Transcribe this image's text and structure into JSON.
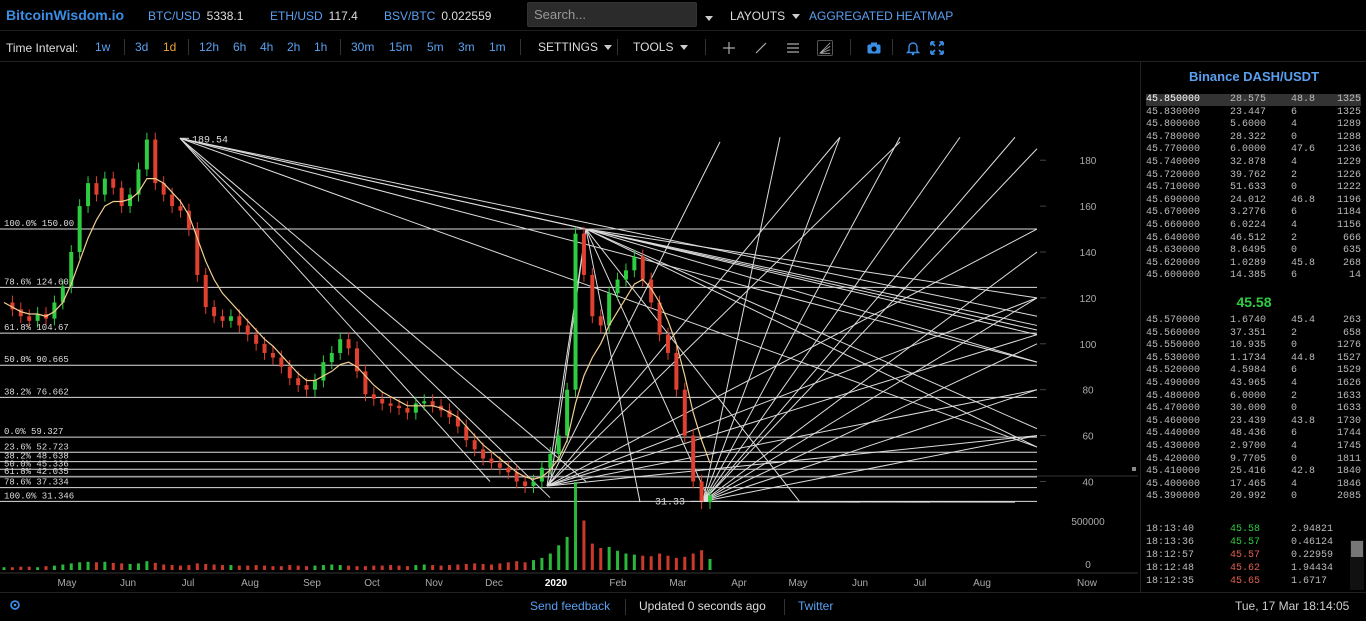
{
  "header": {
    "logo": "BitcoinWisdom.io",
    "tickers": [
      {
        "name": "BTC/USD",
        "value": "5338.1"
      },
      {
        "name": "ETH/USD",
        "value": "117.4"
      },
      {
        "name": "BSV/BTC",
        "value": "0.022559"
      }
    ],
    "search_placeholder": "Search...",
    "layouts_label": "LAYOUTS",
    "heatmap_label": "AGGREGATED HEATMAP"
  },
  "toolbar": {
    "interval_label": "Time Interval:",
    "intervals": [
      "1w",
      "3d",
      "1d",
      "12h",
      "6h",
      "4h",
      "2h",
      "1h",
      "30m",
      "15m",
      "5m",
      "3m",
      "1m"
    ],
    "active_interval": "1d",
    "settings_label": "SETTINGS",
    "tools_label": "TOOLS",
    "tool_icons": [
      "crosshair-icon",
      "line-icon",
      "horizontal-lines-icon",
      "fib-icon",
      "camera-icon",
      "bell-icon",
      "fullscreen-icon"
    ]
  },
  "chart_data": {
    "type": "line",
    "title": "",
    "xlabel": "",
    "ylabel": "",
    "y_ticks": [
      40,
      60,
      80,
      100,
      120,
      140,
      160,
      180
    ],
    "ylim": [
      30,
      195
    ],
    "volume_ticks": [
      "500000",
      "0"
    ],
    "x_ticks": [
      "May",
      "Jun",
      "Jul",
      "Aug",
      "Sep",
      "Oct",
      "Nov",
      "Dec",
      "2020",
      "Feb",
      "Mar",
      "Apr",
      "May",
      "Jun",
      "Jul",
      "Aug",
      "Now"
    ],
    "fib_levels_1": [
      {
        "label": "100.0% 150.00",
        "value": 150.0
      },
      {
        "label": "78.6% 124.60",
        "value": 124.6
      },
      {
        "label": "61.8% 104.67",
        "value": 104.67
      },
      {
        "label": "50.0% 90.665",
        "value": 90.665
      },
      {
        "label": "38.2% 76.662",
        "value": 76.662
      },
      {
        "label": "0.0% 59.327",
        "value": 59.327
      }
    ],
    "fib_levels_2": [
      {
        "label": "23.6% 52.723",
        "value": 52.723
      },
      {
        "label": "38.2% 48.638",
        "value": 48.638
      },
      {
        "label": "50.0% 45.336",
        "value": 45.336
      },
      {
        "label": "61.8% 42.035",
        "value": 42.035
      },
      {
        "label": "78.6% 37.334",
        "value": 37.334
      },
      {
        "label": "100.0% 31.346",
        "value": 31.346
      }
    ],
    "high_label": "189.54",
    "high_value": 189.54,
    "low_label": "31.33",
    "low_value": 31.33,
    "price_series": [
      118,
      115,
      112,
      110,
      113,
      111,
      118,
      125,
      140,
      160,
      170,
      165,
      172,
      168,
      160,
      165,
      176,
      189,
      170,
      165,
      160,
      158,
      150,
      130,
      116,
      112,
      110,
      112,
      108,
      104,
      100,
      96,
      94,
      90,
      85,
      82,
      80,
      84,
      92,
      96,
      102,
      98,
      88,
      78,
      76,
      74,
      73,
      72,
      70,
      74,
      75,
      73,
      71,
      68,
      64,
      58,
      54,
      50,
      48,
      46,
      44,
      40,
      38,
      40,
      46,
      52,
      60,
      80,
      148,
      130,
      112,
      108,
      122,
      128,
      132,
      138,
      128,
      118,
      104,
      96,
      80,
      60,
      40,
      31,
      34
    ],
    "ma_series": [
      118,
      116,
      114,
      113,
      113,
      112,
      114,
      118,
      126,
      136,
      146,
      154,
      160,
      162,
      162,
      163,
      166,
      172,
      172,
      170,
      166,
      162,
      156,
      146,
      136,
      128,
      122,
      118,
      114,
      110,
      106,
      102,
      99,
      95,
      91,
      87,
      84,
      84,
      86,
      88,
      91,
      92,
      90,
      86,
      82,
      79,
      77,
      75,
      73,
      73,
      73,
      73,
      72,
      70,
      68,
      64,
      60,
      56,
      53,
      50,
      47,
      44,
      42,
      41,
      42,
      45,
      50,
      58,
      74,
      86,
      94,
      100,
      108,
      114,
      120,
      126,
      128,
      124,
      118,
      110,
      100,
      86,
      70,
      58,
      48
    ],
    "volume_series": [
      5,
      5,
      6,
      6,
      5,
      7,
      8,
      10,
      12,
      14,
      15,
      14,
      15,
      13,
      12,
      11,
      12,
      16,
      13,
      10,
      9,
      8,
      9,
      12,
      11,
      10,
      9,
      9,
      8,
      8,
      9,
      8,
      7,
      7,
      9,
      8,
      7,
      8,
      9,
      10,
      9,
      8,
      7,
      7,
      8,
      8,
      9,
      8,
      7,
      9,
      10,
      9,
      8,
      9,
      10,
      11,
      12,
      11,
      10,
      12,
      14,
      16,
      14,
      18,
      22,
      30,
      45,
      60,
      160,
      90,
      48,
      40,
      42,
      35,
      30,
      28,
      26,
      25,
      30,
      26,
      22,
      24,
      30,
      36,
      20
    ]
  },
  "orderbook": {
    "title": "Binance DASH/USDT",
    "asks": [
      [
        "45.850000",
        "28.575",
        "48.8",
        "1325"
      ],
      [
        "45.830000",
        "23.447",
        "6",
        "1325"
      ],
      [
        "45.800000",
        "5.6000",
        "4",
        "1289"
      ],
      [
        "45.780000",
        "28.322",
        "0",
        "1288"
      ],
      [
        "45.770000",
        "6.0000",
        "47.6",
        "1236"
      ],
      [
        "45.740000",
        "32.878",
        "4",
        "1229"
      ],
      [
        "45.720000",
        "39.762",
        "2",
        "1226"
      ],
      [
        "45.710000",
        "51.633",
        "0",
        "1222"
      ],
      [
        "45.690000",
        "24.012",
        "46.8",
        "1196"
      ],
      [
        "45.670000",
        "3.2776",
        "6",
        "1184"
      ],
      [
        "45.660000",
        "6.0224",
        "4",
        "1156"
      ],
      [
        "45.640000",
        "46.512",
        "2",
        "666"
      ],
      [
        "45.630000",
        "8.6495",
        "0",
        "635"
      ],
      [
        "45.620000",
        "1.0289",
        "45.8",
        "268"
      ],
      [
        "45.600000",
        "14.385",
        "6",
        "14"
      ]
    ],
    "last_price": "45.58",
    "bids": [
      [
        "45.570000",
        "1.6740",
        "45.4",
        "263"
      ],
      [
        "45.560000",
        "37.351",
        "2",
        "658"
      ],
      [
        "45.550000",
        "10.935",
        "0",
        "1276"
      ],
      [
        "45.530000",
        "1.1734",
        "44.8",
        "1527"
      ],
      [
        "45.520000",
        "4.5984",
        "6",
        "1529"
      ],
      [
        "45.490000",
        "43.965",
        "4",
        "1626"
      ],
      [
        "45.480000",
        "6.0000",
        "2",
        "1633"
      ],
      [
        "45.470000",
        "30.000",
        "0",
        "1633"
      ],
      [
        "45.460000",
        "23.439",
        "43.8",
        "1730"
      ],
      [
        "45.440000",
        "48.436",
        "6",
        "1744"
      ],
      [
        "45.430000",
        "2.9700",
        "4",
        "1745"
      ],
      [
        "45.420000",
        "9.7705",
        "0",
        "1811"
      ],
      [
        "45.410000",
        "25.416",
        "42.8",
        "1840"
      ],
      [
        "45.400000",
        "17.465",
        "4",
        "1846"
      ],
      [
        "45.390000",
        "20.992",
        "0",
        "2085"
      ]
    ],
    "trades": [
      [
        "18:13:40",
        "45.58",
        "2.94821"
      ],
      [
        "18:13:36",
        "45.57",
        "0.46124"
      ],
      [
        "18:12:57",
        "45.57",
        "0.22959"
      ],
      [
        "18:12:48",
        "45.62",
        "1.94434"
      ],
      [
        "18:12:35",
        "45.65",
        "1.6717"
      ]
    ],
    "trade_colors": [
      "#2ecc40",
      "#2ecc40",
      "#e06050",
      "#e06050",
      "#e06050"
    ]
  },
  "status": {
    "feedback": "Send feedback",
    "updated": "Updated 0 seconds ago",
    "twitter": "Twitter",
    "datetime": "Tue, 17 Mar 18:14:05"
  },
  "colors": {
    "accent": "#3a8ee6",
    "active": "#e8a33c",
    "up": "#2ecc40",
    "down": "#e04030",
    "ma": "#f0d090"
  }
}
